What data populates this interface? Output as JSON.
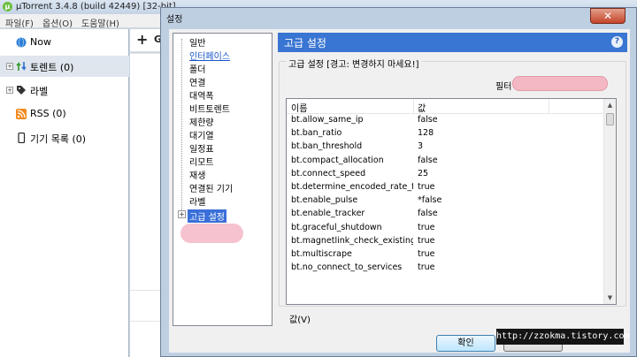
{
  "main_window": {
    "title": "µTorrent 3.4.8  (build 42449) [32-bit]",
    "menu": [
      "파일(F)",
      "옵션(O)",
      "도움말(H)"
    ],
    "sidebar": [
      {
        "label": "Now"
      },
      {
        "label": "토렌트 (0)"
      },
      {
        "label": "라벨"
      },
      {
        "label": "RSS (0)"
      },
      {
        "label": "기기 목록 (0)"
      }
    ],
    "toolbar": {
      "add_label": "+",
      "next_letter": "G"
    }
  },
  "dialog": {
    "title": "설정",
    "close_label": "✕",
    "nav": [
      "일반",
      "인터페이스",
      "폴더",
      "연결",
      "대역폭",
      "비트토렌트",
      "제한량",
      "대기열",
      "일정표",
      "리모트",
      "재생",
      "연결된 기기",
      "라벨",
      "고급 설정"
    ],
    "panel_title": "고급 설정",
    "help_label": "?",
    "group_title": "고급 설정 [경고: 변경하지 마세요!]",
    "filter": {
      "label": "필터",
      "value": ""
    },
    "list": {
      "columns": [
        "이름",
        "값"
      ],
      "rows": [
        {
          "name": "bt.allow_same_ip",
          "value": "false"
        },
        {
          "name": "bt.ban_ratio",
          "value": "128"
        },
        {
          "name": "bt.ban_threshold",
          "value": "3"
        },
        {
          "name": "bt.compact_allocation",
          "value": "false"
        },
        {
          "name": "bt.connect_speed",
          "value": "25"
        },
        {
          "name": "bt.determine_encoded_rate_fo...",
          "value": "true"
        },
        {
          "name": "bt.enable_pulse",
          "value": "*false"
        },
        {
          "name": "bt.enable_tracker",
          "value": "false"
        },
        {
          "name": "bt.graceful_shutdown",
          "value": "true"
        },
        {
          "name": "bt.magnetlink_check_existing_...",
          "value": "true"
        },
        {
          "name": "bt.multiscrape",
          "value": "true"
        },
        {
          "name": "bt.no_connect_to_services",
          "value": "true"
        }
      ]
    },
    "value_label": "값(V)",
    "ok_label": "확인",
    "watermark": "http://zzokma.tistory.com"
  }
}
